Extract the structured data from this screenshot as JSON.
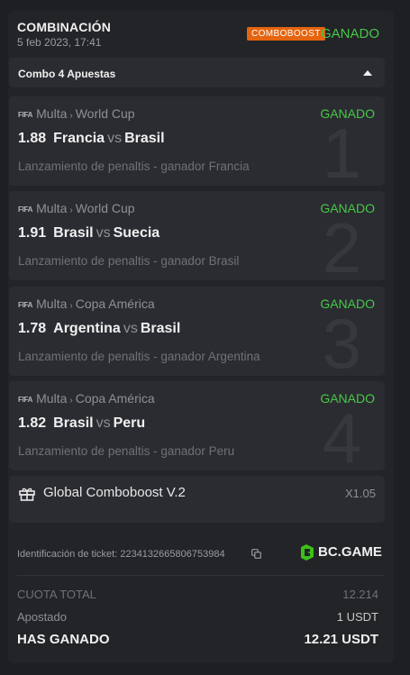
{
  "header": {
    "title": "COMBINACIÓN",
    "date": "5 feb 2023, 17:41",
    "boost_badge": "COMBOBOOST",
    "status": "GANADO"
  },
  "combo": {
    "label": "Combo 4 Apuestas"
  },
  "legs": [
    {
      "number": "1",
      "sport_icon": "fifa-icon",
      "sport_icon_text": "FIFA",
      "sport": "Multa",
      "competition": "World Cup",
      "status": "GANADO",
      "odds": "1.88",
      "team_home": "Francia",
      "vs": "vs",
      "team_away": "Brasil",
      "market": "Lanzamiento de penaltis - ganador Francia"
    },
    {
      "number": "2",
      "sport_icon": "fifa-icon",
      "sport_icon_text": "FIFA",
      "sport": "Multa",
      "competition": "World Cup",
      "status": "GANADO",
      "odds": "1.91",
      "team_home": "Brasil",
      "vs": "vs",
      "team_away": "Suecia",
      "market": "Lanzamiento de penaltis - ganador Brasil"
    },
    {
      "number": "3",
      "sport_icon": "fifa-icon",
      "sport_icon_text": "FIFA",
      "sport": "Multa",
      "competition": "Copa América",
      "status": "GANADO",
      "odds": "1.78",
      "team_home": "Argentina",
      "vs": "vs",
      "team_away": "Brasil",
      "market": "Lanzamiento de penaltis - ganador Argentina"
    },
    {
      "number": "4",
      "sport_icon": "fifa-icon",
      "sport_icon_text": "FIFA",
      "sport": "Multa",
      "competition": "Copa América",
      "status": "GANADO",
      "odds": "1.82",
      "team_home": "Brasil",
      "vs": "vs",
      "team_away": "Peru",
      "market": "Lanzamiento de penaltis - ganador Peru"
    }
  ],
  "boost": {
    "name": "Global Comboboost V.2",
    "multiplier": "X1.05",
    "icon": "gift-icon"
  },
  "ticket": {
    "label": "Identificación de ticket: 2234132665806753984",
    "copy_icon": "copy-icon"
  },
  "brand": {
    "name": "BC.GAME",
    "icon": "bc-game-logo-icon"
  },
  "summary": {
    "total_odds_label": "CUOTA TOTAL",
    "total_odds": "12.214",
    "staked_label": "Apostado",
    "staked": "1 USDT",
    "won_label": "HAS GANADO",
    "won": "12.21 USDT"
  },
  "colors": {
    "win": "#46c848",
    "boost": "#e5640f",
    "background": "#1e1f22",
    "card": "#232428",
    "panel": "#2b2c31"
  }
}
